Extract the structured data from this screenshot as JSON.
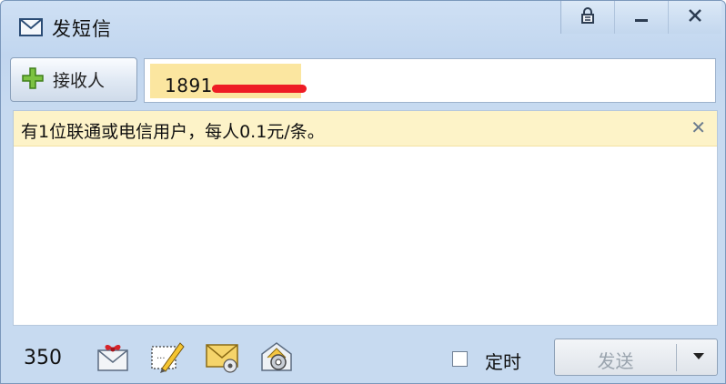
{
  "window": {
    "title": "发短信",
    "controls": [
      "lock-icon",
      "minimize-icon",
      "close-icon"
    ]
  },
  "recipient": {
    "button_label": "接收人",
    "number_visible": "1891",
    "redaction_color": "#ee1c24",
    "chip_color": "#fbe6a0"
  },
  "notice": {
    "text": "有1位联通或电信用户，每人0.1元/条。",
    "close_label": "✕",
    "background": "#fdf3c8"
  },
  "message": {
    "value": ""
  },
  "toolbar": {
    "char_count": "350",
    "tools": [
      "greeting-card-icon",
      "signature-pen-icon",
      "envelope-template-icon",
      "settings-envelope-icon"
    ],
    "timer_label": "定时",
    "timer_checked": false,
    "send_label": "发送"
  }
}
